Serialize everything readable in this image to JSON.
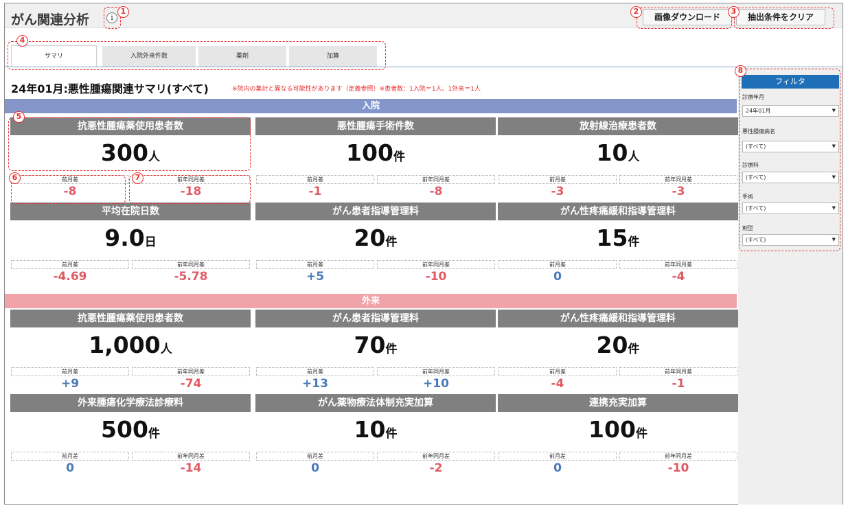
{
  "header": {
    "title": "がん関連分析",
    "info_icon": "i",
    "download_button": "画像ダウンロード",
    "clear_button": "抽出条件をクリア"
  },
  "tabs": [
    {
      "label": "サマリ",
      "active": true
    },
    {
      "label": "入院外来件数",
      "active": false
    },
    {
      "label": "薬剤",
      "active": false
    },
    {
      "label": "加算",
      "active": false
    }
  ],
  "summary": {
    "title": "24年01月:悪性腫瘍関連サマリ(すべて)",
    "note": "※院内の集計と異なる可能性があります（定義参照）※患者数：1入院＝1人、1外来＝1人"
  },
  "sections": {
    "inpatient": {
      "label": "入院",
      "color": "#8496c9"
    },
    "outpatient": {
      "label": "外来",
      "color": "#f0a3a8"
    }
  },
  "diff_labels": {
    "mom": "前月差",
    "yoy": "前年同月差"
  },
  "cards": [
    {
      "title": "抗悪性腫瘍薬使用患者数",
      "value": "300",
      "unit": "人",
      "mom": "-8",
      "mom_color": "red",
      "yoy": "-18",
      "yoy_color": "red"
    },
    {
      "title": "悪性腫瘍手術件数",
      "value": "100",
      "unit": "件",
      "mom": "-1",
      "mom_color": "red",
      "yoy": "-8",
      "yoy_color": "red"
    },
    {
      "title": "放射線治療患者数",
      "value": "10",
      "unit": "人",
      "mom": "-3",
      "mom_color": "red",
      "yoy": "-3",
      "yoy_color": "red"
    },
    {
      "title": "平均在院日数",
      "value": "9.0",
      "unit": "日",
      "mom": "-4.69",
      "mom_color": "red",
      "yoy": "-5.78",
      "yoy_color": "red"
    },
    {
      "title": "がん患者指導管理料",
      "value": "20",
      "unit": "件",
      "mom": "+5",
      "mom_color": "blue",
      "yoy": "-10",
      "yoy_color": "red"
    },
    {
      "title": "がん性疼痛緩和指導管理料",
      "value": "15",
      "unit": "件",
      "mom": "0",
      "mom_color": "blue",
      "yoy": "-4",
      "yoy_color": "red"
    },
    {
      "title": "抗悪性腫瘍薬使用患者数",
      "value": "1,000",
      "unit": "人",
      "mom": "+9",
      "mom_color": "blue",
      "yoy": "-74",
      "yoy_color": "red"
    },
    {
      "title": "がん患者指導管理料",
      "value": "70",
      "unit": "件",
      "mom": "+13",
      "mom_color": "blue",
      "yoy": "+10",
      "yoy_color": "blue"
    },
    {
      "title": "がん性疼痛緩和指導管理料",
      "value": "20",
      "unit": "件",
      "mom": "-4",
      "mom_color": "red",
      "yoy": "-1",
      "yoy_color": "red"
    },
    {
      "title": "外来腫瘍化学療法診療料",
      "value": "500",
      "unit": "件",
      "mom": "0",
      "mom_color": "blue",
      "yoy": "-14",
      "yoy_color": "red"
    },
    {
      "title": "がん薬物療法体制充実加算",
      "value": "10",
      "unit": "件",
      "mom": "0",
      "mom_color": "blue",
      "yoy": "-2",
      "yoy_color": "red"
    },
    {
      "title": "連携充実加算",
      "value": "100",
      "unit": "件",
      "mom": "0",
      "mom_color": "blue",
      "yoy": "-10",
      "yoy_color": "red"
    }
  ],
  "filter": {
    "title": "フィルタ",
    "items": [
      {
        "label": "診療年月",
        "value": "24年01月"
      },
      {
        "label": "悪性腫瘍病名",
        "value": "(すべて)"
      },
      {
        "label": "診療科",
        "value": "(すべて)"
      },
      {
        "label": "手術",
        "value": "(すべて)"
      },
      {
        "label": "剤型",
        "value": "(すべて)"
      }
    ]
  },
  "callouts": [
    "1",
    "2",
    "3",
    "4",
    "5",
    "6",
    "7",
    "8"
  ],
  "colors": {
    "annotation": "#e8312f",
    "filter_header": "#1f6fb8",
    "card_header": "#808080",
    "negative": "#e05a64",
    "positive": "#4a79b8"
  }
}
